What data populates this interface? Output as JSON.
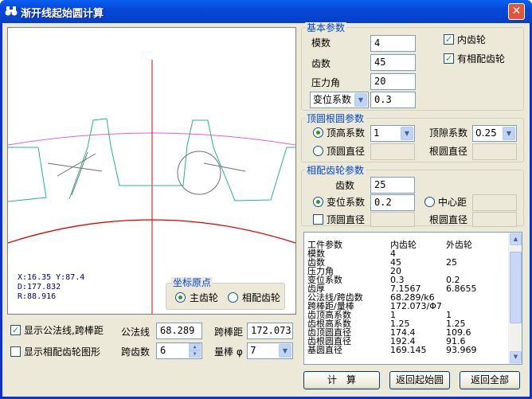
{
  "window": {
    "title": "渐开线起始圆计算",
    "close_glyph": "✕"
  },
  "canvas": {
    "coord_xy": "X:16.35  Y:87.4",
    "coord_d": "D:177.832",
    "coord_r": "R:88.916",
    "origin_group": {
      "title": "坐标原点",
      "main_gear": "主齿轮",
      "mating_gear": "相配齿轮",
      "selected": "main_gear"
    },
    "colors": {
      "axis": "#e00000",
      "addendum_circle": "#e060e0",
      "root_circle": "#e00000",
      "tooth_profile": "#2ab090",
      "guide": "#707070"
    }
  },
  "basic": {
    "title": "基本参数",
    "module_label": "模数",
    "module_value": "4",
    "teeth_label": "齿数",
    "teeth_value": "45",
    "pressure_label": "压力角",
    "pressure_value": "20",
    "shift_combo": "变位系数",
    "shift_value": "0.3",
    "internal_gear": "内齿轮",
    "internal_checked": true,
    "has_mating": "有相配齿轮",
    "mating_checked": true
  },
  "tip_root": {
    "title": "顶圆根圆参数",
    "addendum_coef_label": "顶高系数",
    "addendum_coef_value": "1",
    "addendum_selected": true,
    "tip_dia_label": "顶圆直径",
    "clearance_label": "顶隙系数",
    "clearance_value": "0.25",
    "root_dia_label": "根圆直径"
  },
  "mating": {
    "title": "相配齿轮参数",
    "teeth_label": "齿数",
    "teeth_value": "25",
    "shift_label": "变位系数",
    "shift_value": "0.2",
    "shift_selected": true,
    "center_label": "中心距",
    "tip_dia_label": "顶圆直径",
    "tip_checked": false,
    "root_dia_label": "根圆直径"
  },
  "results": {
    "headers": [
      "工件参数",
      "内齿轮",
      "外齿轮"
    ],
    "rows": [
      [
        "模数",
        "4",
        ""
      ],
      [
        "齿数",
        "45",
        "25"
      ],
      [
        "压力角",
        "20",
        ""
      ],
      [
        "变位系数",
        "0.3",
        "0.2"
      ],
      [
        "齿厚",
        "7.1567",
        "6.8655"
      ],
      [
        "公法线/跨齿数",
        "68.289/k6",
        ""
      ],
      [
        "跨棒距/量棒",
        "172.073/Φ7",
        ""
      ],
      [
        "齿顶高系数",
        "1",
        "1"
      ],
      [
        "齿根高系数",
        "1.25",
        "1.25"
      ],
      [
        "齿顶圆直径",
        "174.4",
        "109.6"
      ],
      [
        "齿根圆直径",
        "192.4",
        "91.6"
      ],
      [
        "基圆直径",
        "169.145",
        "93.969"
      ]
    ]
  },
  "bottom": {
    "show_normal_label": "显示公法线,跨棒距",
    "show_normal_checked": true,
    "show_mating_label": "显示相配齿轮图形",
    "show_mating_checked": false,
    "normal_label": "公法线",
    "normal_value": "68.289",
    "span_label": "跨棒距",
    "span_value": "172.073",
    "span_teeth_label": "跨齿数",
    "span_teeth_value": "6",
    "pin_label": "量棒 φ",
    "pin_value": "7"
  },
  "buttons": {
    "calc": "计　算",
    "return_start": "返回起始圆",
    "return_all": "返回全部"
  }
}
